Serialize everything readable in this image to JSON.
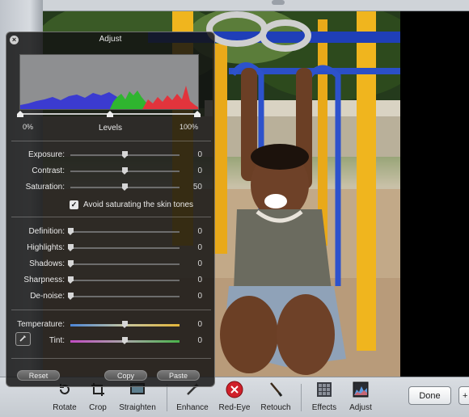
{
  "hud": {
    "title": "Adjust",
    "levels": {
      "label": "Levels",
      "min_label": "0%",
      "max_label": "100%"
    },
    "sliders": [
      {
        "key": "exposure",
        "label": "Exposure:",
        "value": "0",
        "position": 0.5
      },
      {
        "key": "contrast",
        "label": "Contrast:",
        "value": "0",
        "position": 0.5
      },
      {
        "key": "saturation",
        "label": "Saturation:",
        "value": "50",
        "position": 0.5
      },
      {
        "key": "definition",
        "label": "Definition:",
        "value": "0",
        "position": 0.0
      },
      {
        "key": "highlights",
        "label": "Highlights:",
        "value": "0",
        "position": 0.0
      },
      {
        "key": "shadows",
        "label": "Shadows:",
        "value": "0",
        "position": 0.0
      },
      {
        "key": "sharpness",
        "label": "Sharpness:",
        "value": "0",
        "position": 0.0
      },
      {
        "key": "denoise",
        "label": "De-noise:",
        "value": "0",
        "position": 0.0
      },
      {
        "key": "temperature",
        "label": "Temperature:",
        "value": "0",
        "position": 0.5
      },
      {
        "key": "tint",
        "label": "Tint:",
        "value": "0",
        "position": 0.5
      }
    ],
    "skin_tones": {
      "label": "Avoid saturating the skin tones",
      "checked": true
    },
    "buttons": {
      "reset": "Reset",
      "copy": "Copy",
      "paste": "Paste"
    }
  },
  "toolbar": {
    "tools": [
      {
        "label": "Rotate",
        "icon": "rotate-icon"
      },
      {
        "label": "Crop",
        "icon": "crop-icon"
      },
      {
        "label": "Straighten",
        "icon": "straighten-icon"
      },
      {
        "label": "Enhance",
        "icon": "magic-wand-icon"
      },
      {
        "label": "Red-Eye",
        "icon": "red-eye-icon"
      },
      {
        "label": "Retouch",
        "icon": "brush-icon"
      },
      {
        "label": "Effects",
        "icon": "effects-icon"
      },
      {
        "label": "Adjust",
        "icon": "adjust-icon"
      }
    ],
    "done": "Done",
    "more": "+"
  },
  "colors": {
    "hud_bg": "#121212",
    "temperature_cool": "#4c86d8",
    "temperature_warm": "#e3b53a",
    "tint_magenta": "#c14bc2",
    "tint_green": "#49b34a",
    "red_eye": "#d0202a"
  }
}
